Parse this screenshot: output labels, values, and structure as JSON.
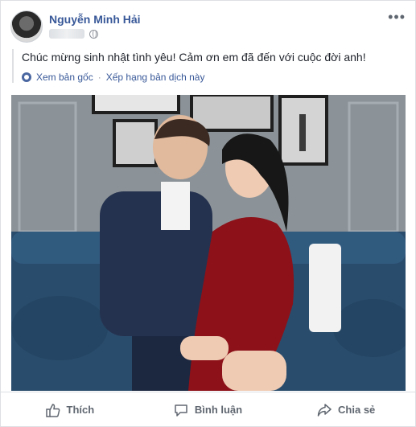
{
  "author": {
    "name": "Nguyễn Minh Hải"
  },
  "post": {
    "caption": "Chúc mừng sinh nhật tình yêu! Cảm ơn em đã đến với cuộc đời anh!",
    "see_original": "Xem bản gốc",
    "separator": "·",
    "rate_translation": "Xếp hạng bản dịch này"
  },
  "actions": {
    "like": "Thích",
    "comment": "Bình luận",
    "share": "Chia sẻ"
  },
  "colors": {
    "link": "#385898",
    "muted": "#606770",
    "border": "#dddfe2"
  }
}
